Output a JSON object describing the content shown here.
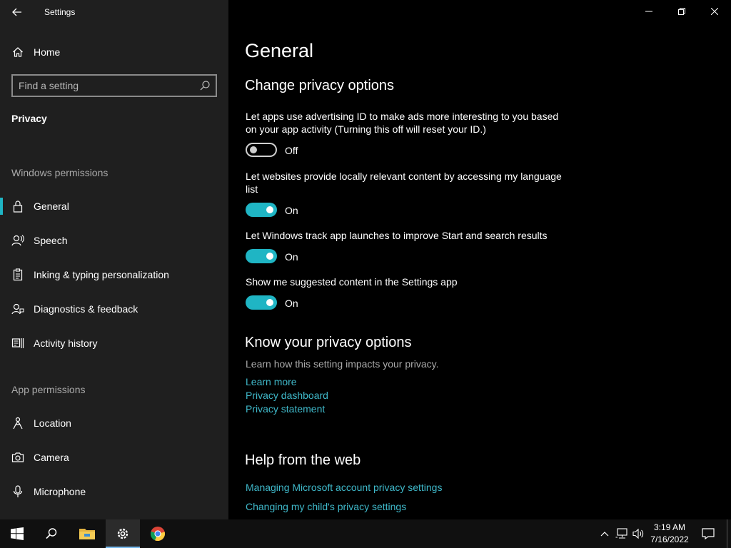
{
  "app": {
    "title": "Settings"
  },
  "sidebar": {
    "home_label": "Home",
    "search_placeholder": "Find a setting",
    "category": "Privacy",
    "windows_permissions_label": "Windows permissions",
    "app_permissions_label": "App permissions",
    "items": [
      {
        "label": "General",
        "icon": "lock-icon",
        "selected": true
      },
      {
        "label": "Speech",
        "icon": "speech-icon",
        "selected": false
      },
      {
        "label": "Inking & typing personalization",
        "icon": "clipboard-icon",
        "selected": false
      },
      {
        "label": "Diagnostics & feedback",
        "icon": "diagnostics-icon",
        "selected": false
      },
      {
        "label": "Activity history",
        "icon": "activity-history-icon",
        "selected": false
      }
    ],
    "app_items": [
      {
        "label": "Location",
        "icon": "location-icon"
      },
      {
        "label": "Camera",
        "icon": "camera-icon"
      },
      {
        "label": "Microphone",
        "icon": "microphone-icon"
      }
    ]
  },
  "main": {
    "page_title": "General",
    "change_privacy_heading": "Change privacy options",
    "settings": [
      {
        "description": "Let apps use advertising ID to make ads more interesting to you based on your app activity (Turning this off will reset your ID.)",
        "state": "Off",
        "on": false
      },
      {
        "description": "Let websites provide locally relevant content by accessing my language list",
        "state": "On",
        "on": true
      },
      {
        "description": "Let Windows track app launches to improve Start and search results",
        "state": "On",
        "on": true
      },
      {
        "description": "Show me suggested content in the Settings app",
        "state": "On",
        "on": true
      }
    ],
    "know_heading": "Know your privacy options",
    "know_desc": "Learn how this setting impacts your privacy.",
    "know_links": [
      "Learn more",
      "Privacy dashboard",
      "Privacy statement"
    ],
    "help_heading": "Help from the web",
    "help_links": [
      "Managing Microsoft account privacy settings",
      "Changing my child's privacy settings"
    ]
  },
  "taskbar": {
    "time": "3:19 AM",
    "date": "7/16/2022"
  },
  "colors": {
    "accent": "#1fb5c4",
    "link": "#3fb8c9",
    "sidebar_bg": "#1f1f1f",
    "main_bg": "#000000"
  }
}
